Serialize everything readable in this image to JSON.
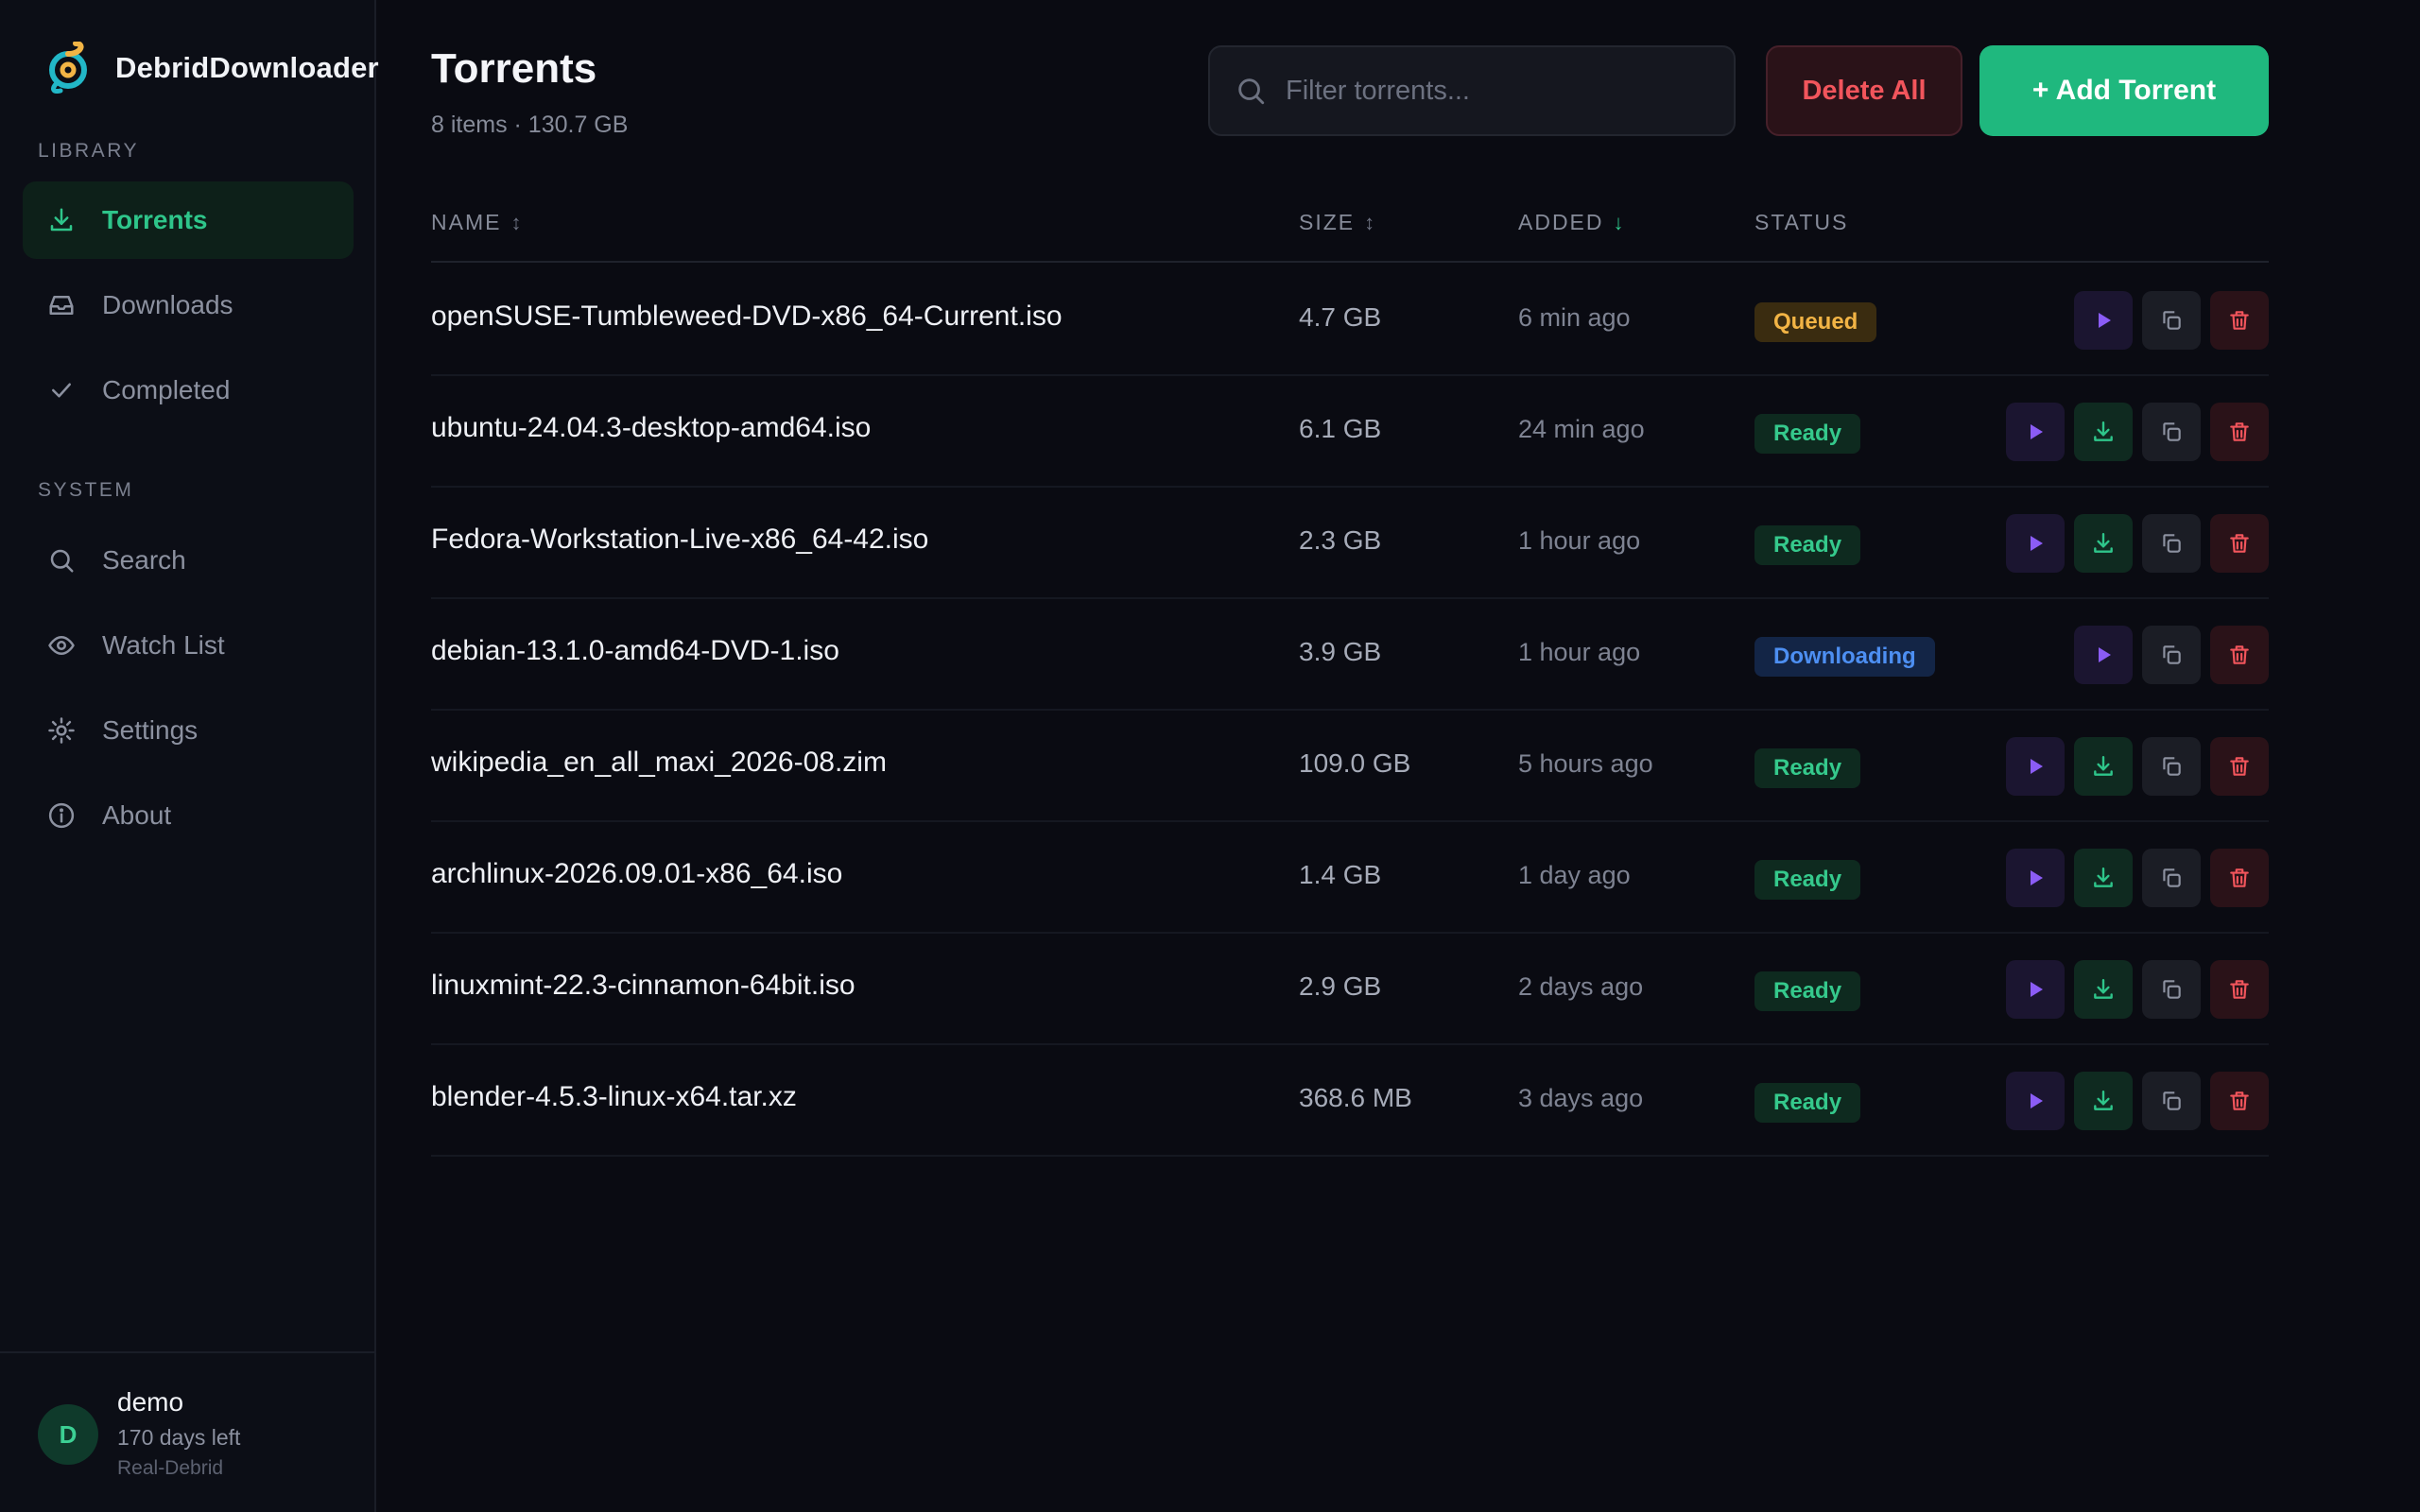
{
  "app": {
    "name": "DebridDownloader"
  },
  "sidebar": {
    "library_label": "LIBRARY",
    "system_label": "SYSTEM",
    "library_items": [
      {
        "label": "Torrents",
        "icon": "download-icon",
        "active": true
      },
      {
        "label": "Downloads",
        "icon": "inbox-icon",
        "active": false
      },
      {
        "label": "Completed",
        "icon": "check-icon",
        "active": false
      }
    ],
    "system_items": [
      {
        "label": "Search",
        "icon": "search-icon"
      },
      {
        "label": "Watch List",
        "icon": "eye-icon"
      },
      {
        "label": "Settings",
        "icon": "gear-icon"
      },
      {
        "label": "About",
        "icon": "info-icon"
      }
    ],
    "user": {
      "initial": "D",
      "name": "demo",
      "days_left": "170 days left",
      "service": "Real-Debrid"
    }
  },
  "main": {
    "title": "Torrents",
    "subtitle": "8 items · 130.7 GB",
    "search_placeholder": "Filter torrents...",
    "delete_all_label": "Delete All",
    "add_label": "+ Add Torrent",
    "columns": {
      "name": "NAME",
      "size": "SIZE",
      "added": "ADDED",
      "status": "STATUS",
      "name_sort": "↕",
      "size_sort": "↕",
      "added_sort": "↓"
    },
    "rows": [
      {
        "name": "openSUSE-Tumbleweed-DVD-x86_64-Current.iso",
        "size": "4.7 GB",
        "added": "6 min ago",
        "status": "Queued",
        "status_type": "queued",
        "downloadable": false
      },
      {
        "name": "ubuntu-24.04.3-desktop-amd64.iso",
        "size": "6.1 GB",
        "added": "24 min ago",
        "status": "Ready",
        "status_type": "ready",
        "downloadable": true
      },
      {
        "name": "Fedora-Workstation-Live-x86_64-42.iso",
        "size": "2.3 GB",
        "added": "1 hour ago",
        "status": "Ready",
        "status_type": "ready",
        "downloadable": true
      },
      {
        "name": "debian-13.1.0-amd64-DVD-1.iso",
        "size": "3.9 GB",
        "added": "1 hour ago",
        "status": "Downloading",
        "status_type": "downloading",
        "downloadable": false
      },
      {
        "name": "wikipedia_en_all_maxi_2026-08.zim",
        "size": "109.0 GB",
        "added": "5 hours ago",
        "status": "Ready",
        "status_type": "ready",
        "downloadable": true
      },
      {
        "name": "archlinux-2026.09.01-x86_64.iso",
        "size": "1.4 GB",
        "added": "1 day ago",
        "status": "Ready",
        "status_type": "ready",
        "downloadable": true
      },
      {
        "name": "linuxmint-22.3-cinnamon-64bit.iso",
        "size": "2.9 GB",
        "added": "2 days ago",
        "status": "Ready",
        "status_type": "ready",
        "downloadable": true
      },
      {
        "name": "blender-4.5.3-linux-x64.tar.xz",
        "size": "368.6 MB",
        "added": "3 days ago",
        "status": "Ready",
        "status_type": "ready",
        "downloadable": true
      }
    ]
  },
  "colors": {
    "accent": "#1fb87e",
    "danger": "#f2555c",
    "play": "#8b5cf6",
    "queued": "#f2b445",
    "downloading": "#4d8ff2"
  }
}
